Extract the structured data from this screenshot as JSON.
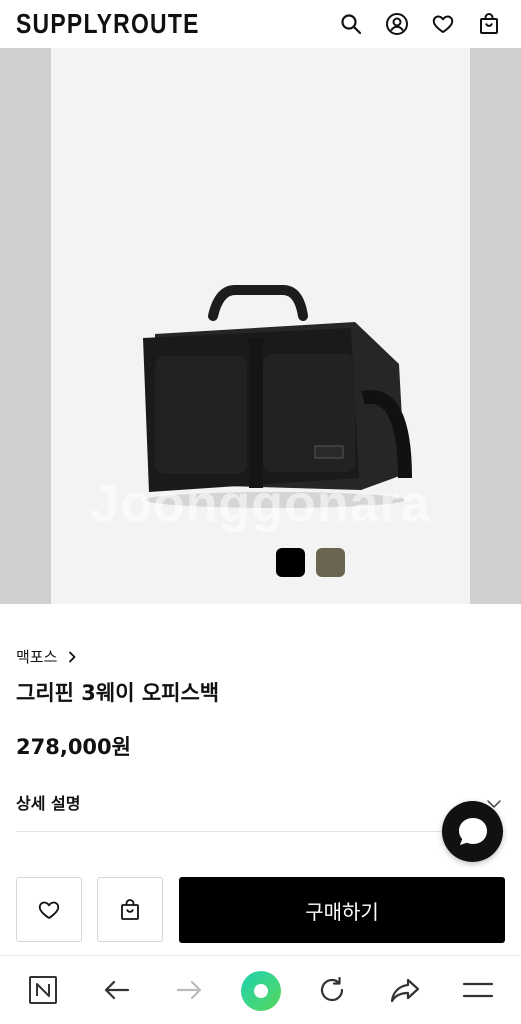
{
  "header": {
    "logo": "SUPPLYROUTE",
    "icons": [
      "search-icon",
      "account-icon",
      "wishlist-heart-icon",
      "cart-bag-icon"
    ]
  },
  "gallery": {
    "watermark": "Joonggonara",
    "swatches": [
      {
        "name": "black",
        "color": "#000000"
      },
      {
        "name": "khaki",
        "color": "#6b6450"
      }
    ]
  },
  "product": {
    "brand": "맥포스",
    "title": "그리핀 3웨이 오피스백",
    "price": "278,000원"
  },
  "detail": {
    "label": "상세 설명"
  },
  "actions": {
    "buy_label": "구매하기",
    "wishlist_icon": "heart-outline-icon",
    "cart_icon": "shopping-bag-icon"
  },
  "browser_nav": {
    "icons": [
      "naver-n-icon",
      "back-arrow-icon",
      "forward-arrow-icon",
      "green-home-dot-icon",
      "refresh-icon",
      "share-icon",
      "menu-icon"
    ]
  },
  "colors": {
    "buy_button": "#000000",
    "accent_green": "#2ed184"
  }
}
